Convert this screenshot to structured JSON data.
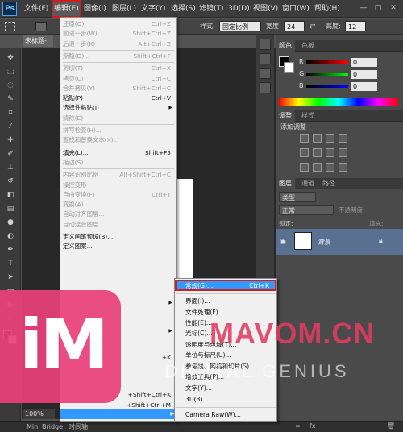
{
  "app": {
    "logo": "Ps"
  },
  "menubar": {
    "items": [
      "文件(F)",
      "编辑(E)",
      "图像(I)",
      "图层(L)",
      "文字(Y)",
      "选择(S)",
      "滤镜(T)",
      "3D(D)",
      "视图(V)",
      "窗口(W)",
      "帮助(H)"
    ],
    "window_controls": [
      "—",
      "□",
      "✕"
    ]
  },
  "options": {
    "style_label": "样式:",
    "style_value": "固定比例",
    "width_label": "宽度:",
    "width_value": "24",
    "height_label": "高度:",
    "height_value": "12"
  },
  "document": {
    "tab": "未标题-",
    "zoom": "100%"
  },
  "edit_menu": [
    {
      "label": "还原(O)",
      "shortcut": "Ctrl+Z",
      "disabled": true
    },
    {
      "label": "前进一步(W)",
      "shortcut": "Shift+Ctrl+Z",
      "disabled": true
    },
    {
      "label": "后退一步(K)",
      "shortcut": "Alt+Ctrl+Z",
      "disabled": true
    },
    {
      "sep": true
    },
    {
      "label": "渐隐(D)...",
      "shortcut": "Shift+Ctrl+F",
      "disabled": true
    },
    {
      "sep": true
    },
    {
      "label": "剪切(T)",
      "shortcut": "Ctrl+X",
      "disabled": true
    },
    {
      "label": "拷贝(C)",
      "shortcut": "Ctrl+C",
      "disabled": true
    },
    {
      "label": "合并拷贝(Y)",
      "shortcut": "Shift+Ctrl+C",
      "disabled": true
    },
    {
      "label": "粘贴(P)",
      "shortcut": "Ctrl+V",
      "disabled": false
    },
    {
      "label": "选择性粘贴(I)",
      "shortcut": "",
      "disabled": false,
      "submenu": true
    },
    {
      "label": "清除(E)",
      "shortcut": "",
      "disabled": true
    },
    {
      "sep": true
    },
    {
      "label": "拼写检查(H)...",
      "shortcut": "",
      "disabled": true
    },
    {
      "label": "查找和替换文本(X)...",
      "shortcut": "",
      "disabled": true
    },
    {
      "sep": true
    },
    {
      "label": "填充(L)...",
      "shortcut": "Shift+F5",
      "disabled": false
    },
    {
      "label": "描边(S)...",
      "shortcut": "",
      "disabled": true
    },
    {
      "sep": true
    },
    {
      "label": "内容识别比例",
      "shortcut": "Alt+Shift+Ctrl+C",
      "disabled": true
    },
    {
      "label": "操控变形",
      "shortcut": "",
      "disabled": true
    },
    {
      "label": "自由变换(F)",
      "shortcut": "Ctrl+T",
      "disabled": true
    },
    {
      "label": "变换(A)",
      "shortcut": "",
      "disabled": true
    },
    {
      "label": "自动对齐图层...",
      "shortcut": "",
      "disabled": true
    },
    {
      "label": "自动混合图层...",
      "shortcut": "",
      "disabled": true
    },
    {
      "sep": true
    },
    {
      "label": "定义画笔预设(B)...",
      "shortcut": "",
      "disabled": false
    },
    {
      "label": "定义图案...",
      "shortcut": "",
      "disabled": false
    }
  ],
  "edit_menu_lower": [
    {
      "label": "",
      "shortcut": "",
      "submenu": true
    },
    {
      "label": "",
      "shortcut": "",
      "submenu": true
    },
    {
      "label": "",
      "shortcut": "+K"
    },
    {
      "label": "",
      "shortcut": ""
    },
    {
      "label": "",
      "shortcut": "+Shift+Ctrl+K"
    },
    {
      "label": "",
      "shortcut": "+Shift+Ctrl+M"
    }
  ],
  "prefs_submenu": [
    {
      "label": "常规(G)...",
      "shortcut": "Ctrl+K"
    },
    {
      "label": "界面(I)..."
    },
    {
      "label": "文件处理(F)..."
    },
    {
      "label": "性能(E)..."
    },
    {
      "label": "光标(C)..."
    },
    {
      "label": "透明度与色域(T)..."
    },
    {
      "label": "单位与标尺(U)..."
    },
    {
      "label": "参考线、网格和切片(S)..."
    },
    {
      "label": "增效工具(P)..."
    },
    {
      "label": "文字(Y)..."
    },
    {
      "label": "3D(3)..."
    },
    {
      "label": "Camera Raw(W)..."
    }
  ],
  "color_panel": {
    "tabs": [
      "颜色",
      "色板"
    ],
    "labels": [
      "R",
      "G",
      "B"
    ],
    "values": [
      "0",
      "0",
      "0"
    ]
  },
  "adjust_panel": {
    "tabs": [
      "调整",
      "样式"
    ],
    "title": "添加调整"
  },
  "layers_panel": {
    "tabs": [
      "图层",
      "通道",
      "路径"
    ],
    "kind": "类型",
    "blend": "正常",
    "opacity_label": "不透明度:",
    "lock_label": "锁定:",
    "fill_label": "填充:",
    "layer_name": "背景"
  },
  "bottom_tabs": [
    "Mini Bridge",
    "时间轴"
  ],
  "watermark": {
    "logo": "iM",
    "site": "MAVOM.CN",
    "tag": "DIGITAL GENIUS"
  },
  "colors": {
    "highlight": "#3399ff",
    "accent_red": "#d21d1d",
    "logo_pink": "#e8417a"
  }
}
